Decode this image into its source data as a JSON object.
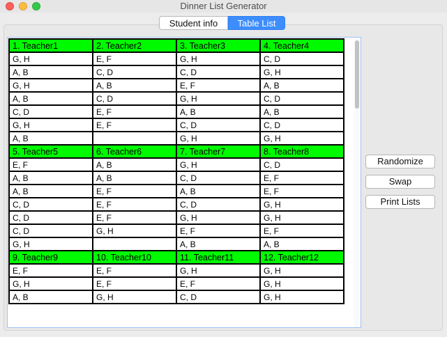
{
  "window": {
    "title": "Dinner List Generator"
  },
  "tabs": [
    {
      "label": "Student info",
      "active": false
    },
    {
      "label": "Table List",
      "active": true
    }
  ],
  "buttons": {
    "randomize": "Randomize",
    "swap": "Swap",
    "print": "Print Lists"
  },
  "table": {
    "blocks": [
      {
        "headers": [
          "1. Teacher1",
          "2. Teacher2",
          "3. Teacher3",
          "4. Teacher4"
        ],
        "rows": [
          [
            "G, H",
            "E, F",
            "G, H",
            "C, D"
          ],
          [
            "A, B",
            "C, D",
            "C, D",
            "G, H"
          ],
          [
            "G, H",
            "A, B",
            "E, F",
            "A, B"
          ],
          [
            "A, B",
            "C, D",
            "G, H",
            "C, D"
          ],
          [
            "C, D",
            "E, F",
            "A, B",
            "A, B"
          ],
          [
            "G, H",
            "E, F",
            "C, D",
            "C, D"
          ],
          [
            "A, B",
            "",
            "G, H",
            "G, H"
          ]
        ]
      },
      {
        "headers": [
          "5. Teacher5",
          "6. Teacher6",
          "7. Teacher7",
          "8. Teacher8"
        ],
        "rows": [
          [
            "E, F",
            "A, B",
            "G, H",
            "C, D"
          ],
          [
            "A, B",
            "A, B",
            "C, D",
            "E, F"
          ],
          [
            "A, B",
            "E, F",
            "A, B",
            "E, F"
          ],
          [
            "C, D",
            "E, F",
            "C, D",
            "G, H"
          ],
          [
            "C, D",
            "E, F",
            "G, H",
            "G, H"
          ],
          [
            "C, D",
            "G, H",
            "E, F",
            "E, F"
          ],
          [
            "G, H",
            "",
            "A, B",
            "A, B"
          ]
        ]
      },
      {
        "headers": [
          "9. Teacher9",
          "10. Teacher10",
          "11. Teacher11",
          "12. Teacher12"
        ],
        "rows": [
          [
            "E, F",
            "E, F",
            "G, H",
            "G, H"
          ],
          [
            "G, H",
            "E, F",
            "E, F",
            "G, H"
          ],
          [
            "A, B",
            "G, H",
            "C, D",
            "G, H"
          ]
        ]
      }
    ]
  }
}
